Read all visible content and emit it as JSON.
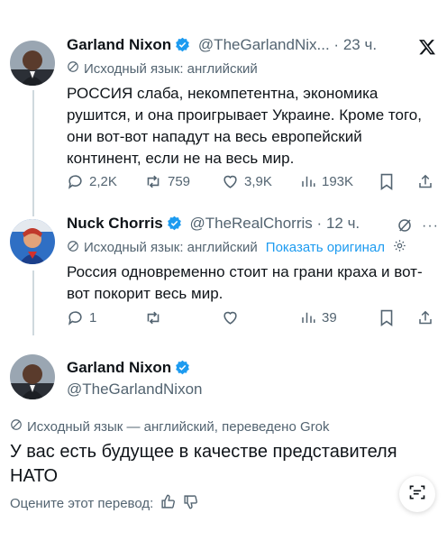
{
  "tweet1": {
    "author_name": "Garland Nixon",
    "handle": "@TheGarlandNix...",
    "separator": "·",
    "time": "23 ч.",
    "translation_note": "Исходный язык: английский",
    "text": "РОССИЯ слаба, некомпетентна, экономика рушится, и она проигрывает Украине. Кроме того, они вот-вот нападут на весь европейский континент, если не на весь мир.",
    "replies": "2,2K",
    "reposts": "759",
    "likes": "3,9K",
    "views": "193K",
    "icons": {
      "close": "x-logo-icon"
    }
  },
  "tweet2": {
    "author_name": "Nuck Chorris",
    "handle": "@TheRealChorris",
    "separator": "·",
    "time": "12 ч.",
    "translation_note": "Исходный язык: английский",
    "show_original": "Показать оригинал",
    "text": "Россия одновременно стоит на грани краха и вот-вот покорит весь мир.",
    "replies": "1",
    "reposts": "",
    "likes": "",
    "views": "39"
  },
  "tweet3": {
    "author_name": "Garland Nixon",
    "handle": "@TheGarlandNixon",
    "translation_note": "Исходный язык — английский, переведено Grok",
    "text": "У вас есть будущее в качестве представителя НАТО",
    "rate_translation": "Оцените этот перевод:"
  },
  "colors": {
    "accent": "#1d9bf0",
    "muted": "#536471",
    "text": "#0f1419"
  }
}
